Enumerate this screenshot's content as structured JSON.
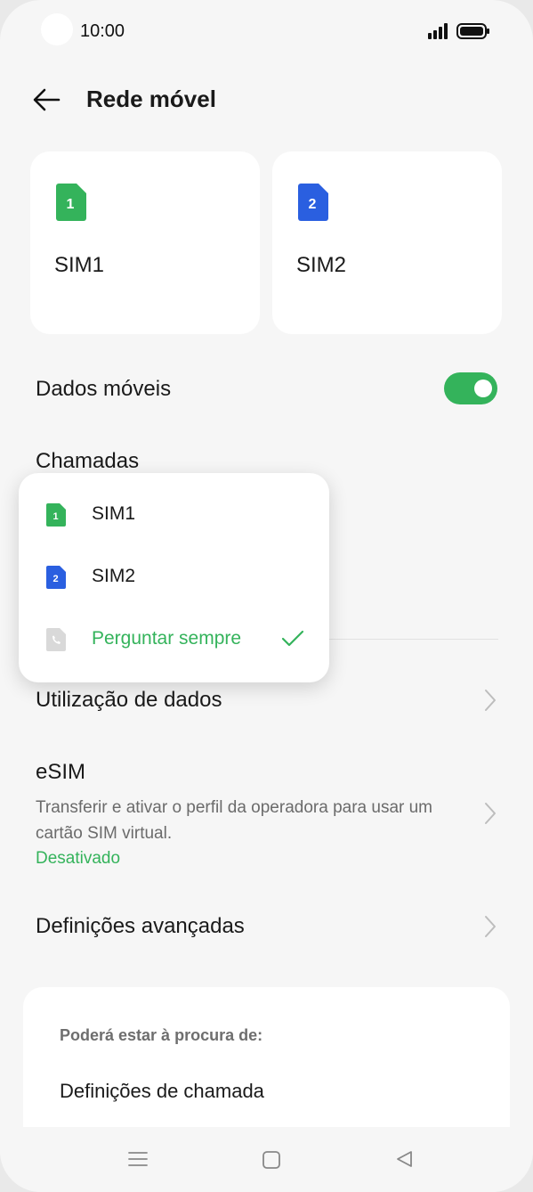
{
  "status_bar": {
    "time": "10:00"
  },
  "header": {
    "title": "Rede móvel"
  },
  "sim_cards": [
    {
      "name": "SIM1",
      "number": "1",
      "color": "#34b35b"
    },
    {
      "name": "SIM2",
      "number": "2",
      "color": "#2a5fe0"
    }
  ],
  "mobile_data": {
    "label": "Dados móveis",
    "enabled": true
  },
  "calls": {
    "label": "Chamadas"
  },
  "popup": {
    "items": [
      {
        "label": "SIM1",
        "icon": "sim1-icon",
        "selected": false
      },
      {
        "label": "SIM2",
        "icon": "sim2-icon",
        "selected": false
      },
      {
        "label": "Perguntar sempre",
        "icon": "phone-icon",
        "selected": true
      }
    ]
  },
  "data_usage": {
    "label": "Utilização de dados"
  },
  "esim": {
    "label": "eSIM",
    "description": "Transferir e ativar o perfil da operadora para usar um cartão SIM virtual.",
    "status": "Desativado"
  },
  "advanced": {
    "label": "Definições avançadas"
  },
  "suggestions": {
    "heading": "Poderá estar à procura de:",
    "item": "Definições de chamada"
  },
  "colors": {
    "accent": "#34b35b",
    "sim2": "#2a5fe0"
  }
}
